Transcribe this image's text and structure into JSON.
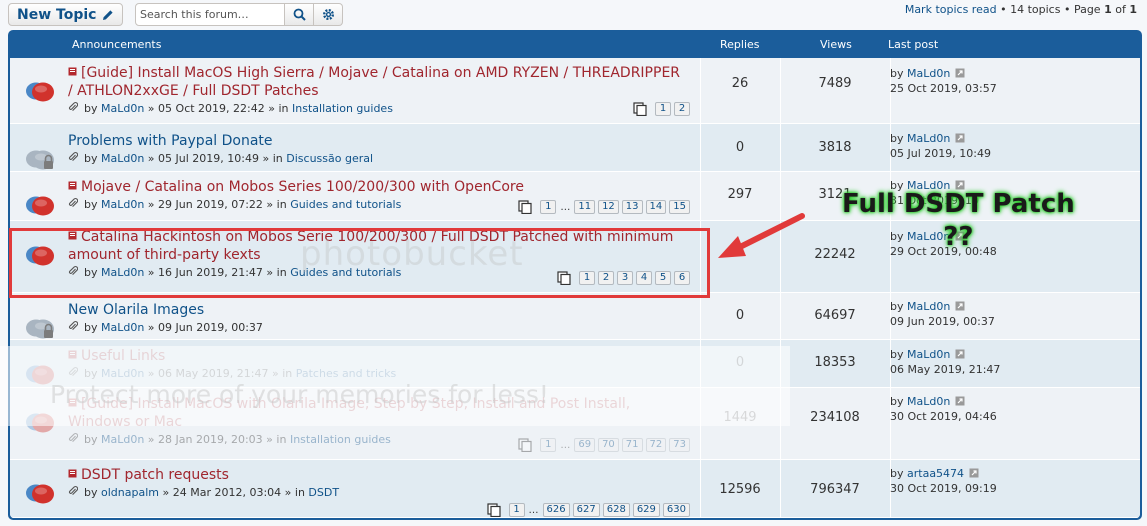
{
  "toolbar": {
    "new_topic_label": "New Topic",
    "search_placeholder": "Search this forum…",
    "mark_read": "Mark topics read",
    "topics_count": "14 topics",
    "page_prefix": "Page",
    "page_current": "1",
    "page_of": "of",
    "page_total": "1"
  },
  "header": {
    "announcements": "Announcements",
    "replies": "Replies",
    "views": "Views",
    "last_post": "Last post"
  },
  "topics": [
    {
      "title": "[Guide] Install MacOS High Sierra / Mojave / Catalina on AMD RYZEN / THREADRIPPER / ATHLON2xxGE / Full DSDT Patches",
      "by": "by",
      "author": "MaLd0n",
      "date": "05 Oct 2019, 22:42",
      "in": "in",
      "forum": "Installation guides",
      "pages": [
        "1",
        "2"
      ],
      "replies": "26",
      "views": "7489",
      "last_by": "MaLd0n",
      "last_date": "25 Oct 2019, 03:57"
    },
    {
      "title": "Problems with Paypal Donate",
      "by": "by",
      "author": "MaLd0n",
      "date": "05 Jul 2019, 10:49",
      "in": "in",
      "forum": "Discussão geral",
      "pages": [],
      "replies": "0",
      "views": "3818",
      "last_by": "MaLd0n",
      "last_date": "05 Jul 2019, 10:49"
    },
    {
      "title": "Mojave / Catalina on Mobos Series 100/200/300 with OpenCore",
      "by": "by",
      "author": "MaLd0n",
      "date": "29 Jun 2019, 07:22",
      "in": "in",
      "forum": "Guides and tutorials",
      "pages": [
        "1",
        "…",
        "11",
        "12",
        "13",
        "14",
        "15"
      ],
      "replies": "297",
      "views": "3121",
      "last_by": "MaLd0n",
      "last_date": "31 Oct 2019, 10"
    },
    {
      "title": "Catalina Hackintosh on Mobos Serie 100/200/300 / Full DSDT Patched with minimum amount of third-party kexts",
      "by": "by",
      "author": "MaLd0n",
      "date": "16 Jun 2019, 21:47",
      "in": "in",
      "forum": "Guides and tutorials",
      "pages": [
        "1",
        "2",
        "3",
        "4",
        "5",
        "6"
      ],
      "replies": "",
      "views": "22242",
      "last_by": "MaLd0n",
      "last_date": "29 Oct 2019, 00:48"
    },
    {
      "title": "New Olarila Images",
      "by": "by",
      "author": "MaLd0n",
      "date": "09 Jun 2019, 00:37",
      "in": "",
      "forum": "",
      "pages": [],
      "replies": "0",
      "views": "64697",
      "last_by": "MaLd0n",
      "last_date": "09 Jun 2019, 00:37"
    },
    {
      "title": "Useful Links",
      "by": "by",
      "author": "MaLd0n",
      "date": "06 May 2019, 21:47",
      "in": "in",
      "forum": "Patches and tricks",
      "pages": [],
      "replies": "0",
      "views": "18353",
      "last_by": "MaLd0n",
      "last_date": "06 May 2019, 21:47"
    },
    {
      "title": "[Guide] Install MacOS with Olarila Image, Step by Step, Install and Post Install, Windows or Mac",
      "by": "by",
      "author": "MaLd0n",
      "date": "28 Jan 2019, 20:03",
      "in": "in",
      "forum": "Installation guides",
      "pages": [
        "1",
        "…",
        "69",
        "70",
        "71",
        "72",
        "73"
      ],
      "replies": "1449",
      "views": "234108",
      "last_by": "MaLd0n",
      "last_date": "30 Oct 2019, 04:46"
    },
    {
      "title": "DSDT patch requests",
      "by": "by",
      "author": "oldnapalm",
      "date": "24 Mar 2012, 03:04",
      "in": "in",
      "forum": "DSDT",
      "pages": [
        "1",
        "…",
        "626",
        "627",
        "628",
        "629",
        "630"
      ],
      "replies": "12596",
      "views": "796347",
      "last_by": "artaa5474",
      "last_date": "30 Oct 2019, 09:19"
    }
  ],
  "annotation": {
    "line1": "Full DSDT Patch",
    "line2": "??"
  },
  "watermark": {
    "logo": "photobucket",
    "text": "Protect more of your memories for less!"
  },
  "colors": {
    "header_blue": "#1b5d9b",
    "link_blue": "#105289",
    "sticky_red": "#a0262e",
    "highlight_red": "#e13a3a",
    "annotation_glow": "#2dcc2d"
  },
  "icons": {
    "new_topic": "pencil-icon",
    "search": "search-icon",
    "advanced_search": "gear-icon",
    "attachment": "paperclip-icon",
    "goto_last": "goto-last-post-icon",
    "pages": "pages-icon",
    "status": "topic-status-icon"
  }
}
